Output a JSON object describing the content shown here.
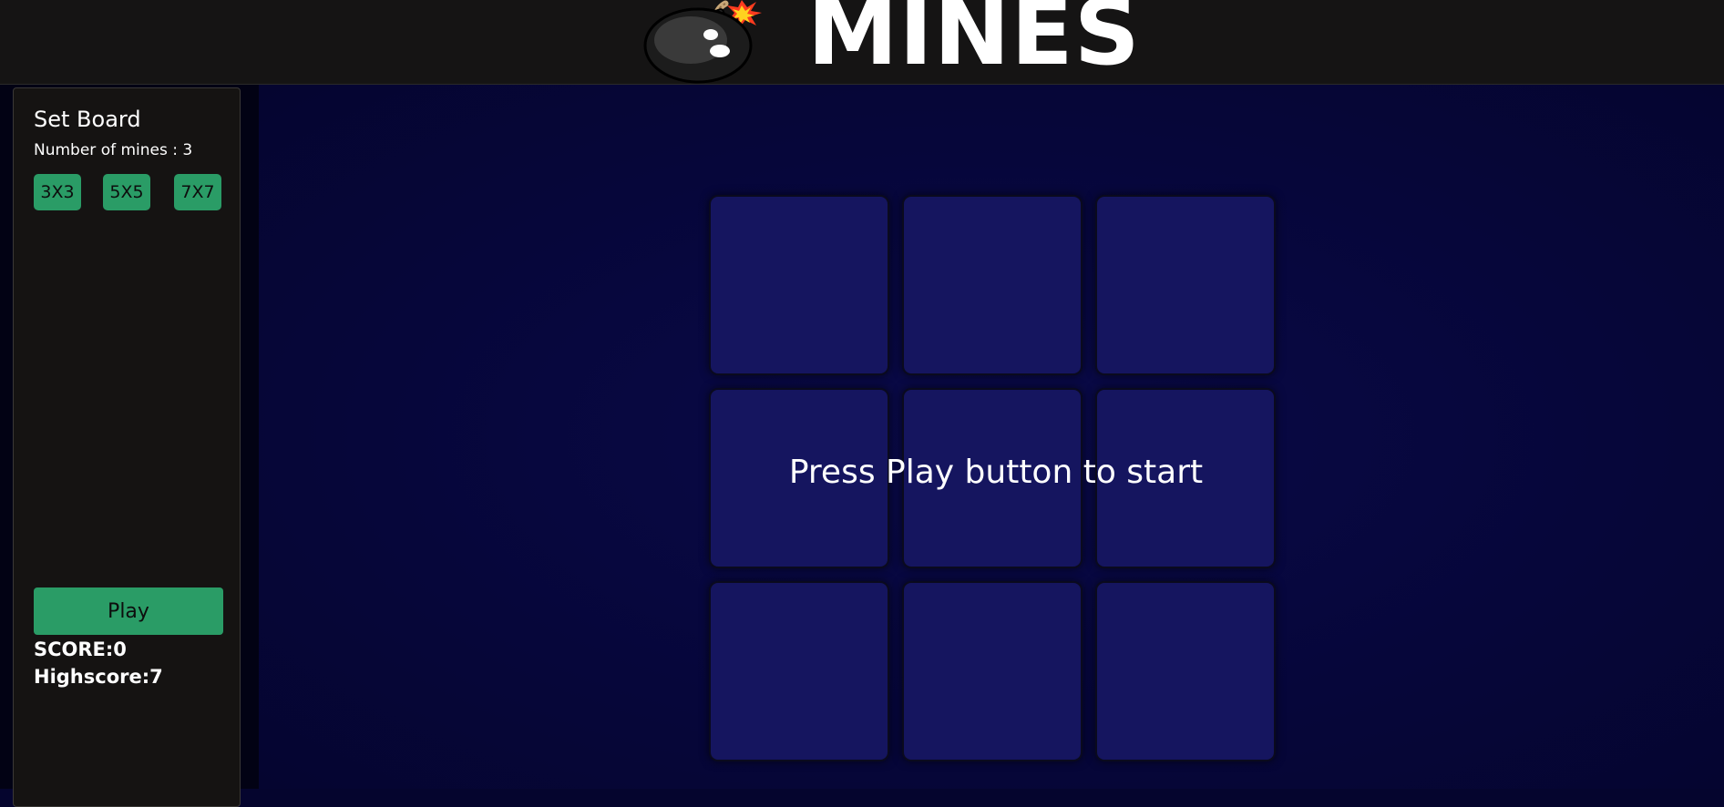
{
  "header": {
    "title": "MINES",
    "logo_icon": "bomb-icon"
  },
  "sidebar": {
    "heading": "Set Board",
    "mines_label": "Number of mines : 3",
    "size_options": [
      "3X3",
      "5X5",
      "7X7"
    ],
    "play_label": "Play",
    "score_label": "SCORE:0",
    "highscore_label": "Highscore:7"
  },
  "board": {
    "rows": 3,
    "cols": 3,
    "message": "Press Play button to start"
  },
  "colors": {
    "header_bg": "#151414",
    "sidebar_bg": "#151312",
    "accent_green": "#2a9c66",
    "board_bg": "#06063a",
    "cell_bg": "#15155f"
  }
}
